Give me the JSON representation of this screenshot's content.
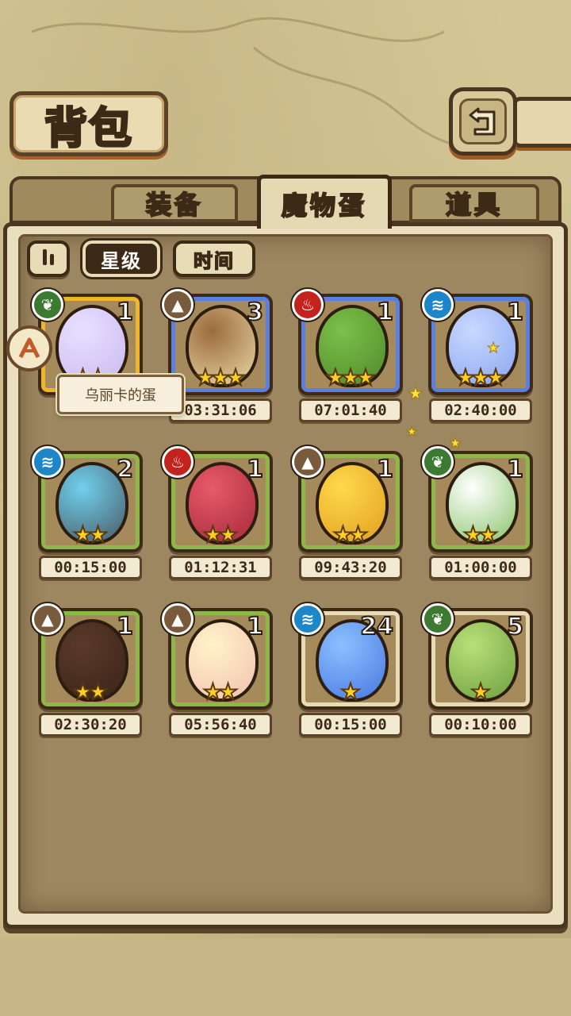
{
  "header": {
    "title": "背包"
  },
  "tabs": [
    {
      "label": "装备",
      "active": false
    },
    {
      "label": "魔物蛋",
      "active": true
    },
    {
      "label": "道具",
      "active": false
    }
  ],
  "filters": {
    "sort_icon": "sort-toggle-icon",
    "star_label": "星级",
    "time_label": "时间",
    "selected": "星级"
  },
  "tooltip": {
    "text": "乌丽卡的蛋"
  },
  "eggs": [
    {
      "count": "1",
      "element": "grass",
      "stars": 2,
      "timer": "",
      "colors": [
        "#e9e0ff",
        "#c9b8f0"
      ],
      "frame": "gold"
    },
    {
      "count": "3",
      "element": "earth",
      "stars": 3,
      "timer": "03:31:06",
      "colors": [
        "#9c6b3c",
        "#e9d8a8"
      ],
      "frame": "blue"
    },
    {
      "count": "1",
      "element": "fire",
      "stars": 3,
      "timer": "07:01:40",
      "colors": [
        "#7cc04a",
        "#4e8a2a"
      ],
      "frame": "blue"
    },
    {
      "count": "1",
      "element": "water",
      "stars": 3,
      "timer": "02:40:00",
      "colors": [
        "#c9d8ff",
        "#8aa6f0"
      ],
      "frame": "blue"
    },
    {
      "count": "2",
      "element": "water",
      "stars": 2,
      "timer": "00:15:00",
      "colors": [
        "#6fd0ec",
        "#4a5a66"
      ],
      "frame": "green"
    },
    {
      "count": "1",
      "element": "fire",
      "stars": 2,
      "timer": "01:12:31",
      "colors": [
        "#e85a6a",
        "#a52a3a"
      ],
      "frame": "green"
    },
    {
      "count": "1",
      "element": "earth",
      "stars": 2,
      "timer": "09:43:20",
      "colors": [
        "#ffd84a",
        "#e0a020"
      ],
      "frame": "green"
    },
    {
      "count": "1",
      "element": "grass",
      "stars": 2,
      "timer": "01:00:00",
      "colors": [
        "#ffffff",
        "#88c46a"
      ],
      "frame": "green"
    },
    {
      "count": "1",
      "element": "earth",
      "stars": 2,
      "timer": "02:30:20",
      "colors": [
        "#5a3a2a",
        "#3a2418"
      ],
      "frame": "green"
    },
    {
      "count": "1",
      "element": "earth",
      "stars": 2,
      "timer": "05:56:40",
      "colors": [
        "#fff3c8",
        "#f2c2b0"
      ],
      "frame": "green"
    },
    {
      "count": "24",
      "element": "water",
      "stars": 1,
      "timer": "00:15:00",
      "colors": [
        "#8ac0ff",
        "#4a78e0"
      ],
      "frame": "plain"
    },
    {
      "count": "5",
      "element": "grass",
      "stars": 1,
      "timer": "00:10:00",
      "colors": [
        "#b8e07a",
        "#6ea040"
      ],
      "frame": "plain"
    }
  ]
}
